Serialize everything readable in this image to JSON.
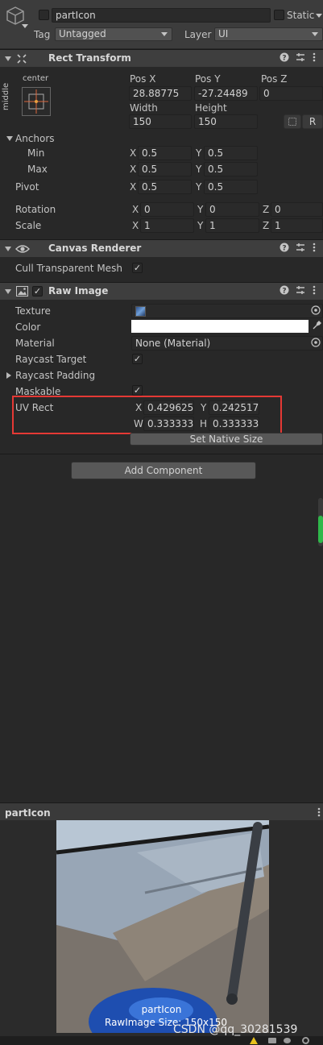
{
  "object": {
    "name": "partIcon",
    "static_label": "Static",
    "tag_label": "Tag",
    "tag_value": "Untagged",
    "layer_label": "Layer",
    "layer_value": "UI"
  },
  "rect_transform": {
    "title": "Rect Transform",
    "anchor_preset_top": "center",
    "anchor_preset_side": "middle",
    "pos_x_label": "Pos X",
    "pos_y_label": "Pos Y",
    "pos_z_label": "Pos Z",
    "pos_x": "28.88775",
    "pos_y": "-27.24489",
    "pos_z": "0",
    "width_label": "Width",
    "height_label": "Height",
    "width": "150",
    "height": "150",
    "r_button": "R",
    "anchors_label": "Anchors",
    "min_label": "Min",
    "max_label": "Max",
    "pivot_label": "Pivot",
    "anchor_min_x": "0.5",
    "anchor_min_y": "0.5",
    "anchor_max_x": "0.5",
    "anchor_max_y": "0.5",
    "pivot_x": "0.5",
    "pivot_y": "0.5",
    "rotation_label": "Rotation",
    "scale_label": "Scale",
    "rotation": {
      "x": "0",
      "y": "0",
      "z": "0"
    },
    "scale": {
      "x": "1",
      "y": "1",
      "z": "1"
    },
    "axis_x": "X",
    "axis_y": "Y",
    "axis_z": "Z",
    "axis_w": "W",
    "axis_h": "H"
  },
  "canvas_renderer": {
    "title": "Canvas Renderer",
    "cull_label": "Cull Transparent Mesh",
    "cull_checked": "✓"
  },
  "raw_image": {
    "title": "Raw Image",
    "texture_label": "Texture",
    "color_label": "Color",
    "material_label": "Material",
    "material_value": "None (Material)",
    "raycast_target_label": "Raycast Target",
    "raycast_target_checked": "✓",
    "raycast_padding_label": "Raycast Padding",
    "maskable_label": "Maskable",
    "maskable_checked": "✓",
    "uv_rect_label": "UV Rect",
    "uv_x": "0.4296258",
    "uv_y": "0.242517",
    "uv_w": "0.3333333",
    "uv_h": "0.3333333",
    "set_native_size": "Set Native Size",
    "highlight_color": "#e53935"
  },
  "add_component": "Add Component",
  "preview": {
    "title": "partIcon",
    "caption_name": "partIcon",
    "caption_size": "RawImage Size: 150x150"
  },
  "watermark": "CSDN @qq_30281539"
}
